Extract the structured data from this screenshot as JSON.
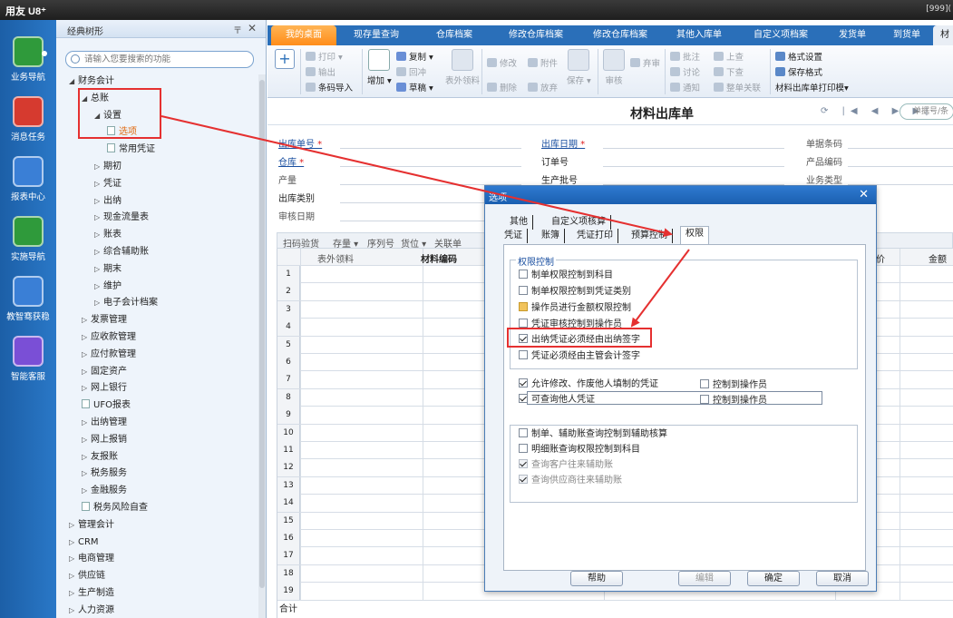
{
  "titlebar": {
    "logo": "用友 U8⁺",
    "account": "[999]("
  },
  "leftnav": [
    {
      "label": "业务导航",
      "icon": "business-nav-icon",
      "color": "#2f9a3b"
    },
    {
      "label": "消息任务",
      "icon": "message-task-icon",
      "color": "#d63a2f"
    },
    {
      "label": "报表中心",
      "icon": "report-center-icon",
      "color": "#3a7fd6"
    },
    {
      "label": "实施导航",
      "icon": "implement-nav-icon",
      "color": "#2f9a3b"
    },
    {
      "label": "教智骞获稳",
      "icon": "education-icon",
      "color": "#3a7fd6"
    },
    {
      "label": "智能客服",
      "icon": "smart-service-icon",
      "color": "#7a4fd6"
    }
  ],
  "tree": {
    "header": "经典树形",
    "pin": "〒",
    "close": "✕",
    "search_placeholder": "请输入您要搜索的功能",
    "nodes": [
      {
        "label": "财务会计",
        "arrow": "◢",
        "doc": false
      },
      {
        "label": "总账",
        "arrow": "◢",
        "doc": false
      },
      {
        "label": "设置",
        "arrow": "◢",
        "doc": false
      },
      {
        "label": "选项",
        "arrow": "",
        "doc": true
      },
      {
        "label": "常用凭证",
        "arrow": "",
        "doc": true
      },
      {
        "label": "期初",
        "arrow": "▷",
        "doc": false
      },
      {
        "label": "凭证",
        "arrow": "▷",
        "doc": false
      },
      {
        "label": "出纳",
        "arrow": "▷",
        "doc": false
      },
      {
        "label": "现金流量表",
        "arrow": "▷",
        "doc": false
      },
      {
        "label": "账表",
        "arrow": "▷",
        "doc": false
      },
      {
        "label": "综合辅助账",
        "arrow": "▷",
        "doc": false
      },
      {
        "label": "期末",
        "arrow": "▷",
        "doc": false
      },
      {
        "label": "维护",
        "arrow": "▷",
        "doc": false
      },
      {
        "label": "电子会计档案",
        "arrow": "▷",
        "doc": false
      },
      {
        "label": "发票管理",
        "arrow": "▷",
        "doc": false
      },
      {
        "label": "应收款管理",
        "arrow": "▷",
        "doc": false
      },
      {
        "label": "应付款管理",
        "arrow": "▷",
        "doc": false
      },
      {
        "label": "固定资产",
        "arrow": "▷",
        "doc": false
      },
      {
        "label": "网上银行",
        "arrow": "▷",
        "doc": false
      },
      {
        "label": "UFO报表",
        "arrow": "",
        "doc": true
      },
      {
        "label": "出纳管理",
        "arrow": "▷",
        "doc": false
      },
      {
        "label": "网上报销",
        "arrow": "▷",
        "doc": false
      },
      {
        "label": "友报账",
        "arrow": "▷",
        "doc": false
      },
      {
        "label": "税务服务",
        "arrow": "▷",
        "doc": false
      },
      {
        "label": "金融服务",
        "arrow": "▷",
        "doc": false
      },
      {
        "label": "税务风险自查",
        "arrow": "",
        "doc": true
      },
      {
        "label": "管理会计",
        "arrow": "▷",
        "doc": false
      },
      {
        "label": "CRM",
        "arrow": "▷",
        "doc": false
      },
      {
        "label": "电商管理",
        "arrow": "▷",
        "doc": false
      },
      {
        "label": "供应链",
        "arrow": "▷",
        "doc": false
      },
      {
        "label": "生产制造",
        "arrow": "▷",
        "doc": false
      },
      {
        "label": "人力资源",
        "arrow": "▷",
        "doc": false
      }
    ]
  },
  "tabs": [
    "我的桌面",
    "现存量查询",
    "仓库档案",
    "修改仓库档案",
    "修改仓库档案",
    "其他入库单",
    "自定义项档案",
    "发货单",
    "到货单",
    "材"
  ],
  "toolbar": {
    "add_big": "+",
    "print": "打印",
    "output": "输出",
    "barcode_import": "条码导入",
    "add": "增加",
    "copy": "复制",
    "red_reverse": "回冲",
    "draft": "草稿",
    "outer_material": "表外领料",
    "modify": "修改",
    "attachment": "附件",
    "save": "保存",
    "delete": "删除",
    "discard": "放弃",
    "audit": "审核",
    "abandon": "弃审",
    "annotate": "批注",
    "discuss": "讨论",
    "notify": "通知",
    "up": "上查",
    "down": "下查",
    "full_link": "整单关联",
    "format_settings": "格式设置",
    "save_format": "保存格式",
    "print_template": "材料出库单打印模▾"
  },
  "form": {
    "title": "材料出库单",
    "nav": "⟳ |◀ ◀ ▶ ▶|",
    "doc_search": "单据号/条",
    "fields": {
      "outbound_no": "出库单号",
      "outbound_date": "出库日期",
      "barcode": "单据条码",
      "warehouse": "仓库",
      "order_no": "订单号",
      "product_code": "产品编码",
      "output": "产量",
      "batch_no": "生产批号",
      "business_type": "业务类型",
      "outbound_category": "出库类别",
      "audit_date": "审核日期"
    },
    "grid_toolbar": [
      "扫码验货",
      "存量 ▾",
      "序列号",
      "货位 ▾",
      "关联单"
    ],
    "columns": [
      "表外领料",
      "材料编码",
      "价",
      "金额"
    ],
    "rows": [
      "1",
      "2",
      "3",
      "4",
      "5",
      "6",
      "7",
      "8",
      "9",
      "10",
      "11",
      "12",
      "13",
      "14",
      "15",
      "16",
      "17",
      "18",
      "19"
    ],
    "total_label": "合计"
  },
  "dialog": {
    "title": "选项",
    "close": "✕",
    "tabs_row1": [
      "其他",
      "自定义项核算"
    ],
    "tabs_row2": [
      "凭证",
      "账簿",
      "凭证打印",
      "预算控制",
      "权限"
    ],
    "group_title": "权限控制",
    "checks": [
      {
        "label": "制单权限控制到科目",
        "checked": false
      },
      {
        "label": "制单权限控制到凭证类别",
        "checked": false
      },
      {
        "label": "操作员进行金额权限控制",
        "checked": false
      },
      {
        "label": "凭证审核控制到操作员",
        "checked": false
      },
      {
        "label": "出纳凭证必须经由出纳签字",
        "checked": true
      },
      {
        "label": "凭证必须经由主管会计签字",
        "checked": false
      }
    ],
    "checks2": [
      {
        "label": "允许修改、作废他人填制的凭证",
        "checked": true
      },
      {
        "label": "控制到操作员",
        "checked": false
      },
      {
        "label": "可查询他人凭证",
        "checked": true
      },
      {
        "label": "控制到操作员",
        "checked": false
      }
    ],
    "checks3": [
      {
        "label": "制单、辅助账查询控制到辅助核算",
        "checked": false
      },
      {
        "label": "明细账查询权限控制到科目",
        "checked": false
      },
      {
        "label": "查询客户往来辅助账",
        "checked": true
      },
      {
        "label": "查询供应商往来辅助账",
        "checked": true
      }
    ],
    "buttons": {
      "help": "帮助",
      "edit": "编辑",
      "ok": "确定",
      "cancel": "取消"
    }
  },
  "annotation_color": "#e53030"
}
